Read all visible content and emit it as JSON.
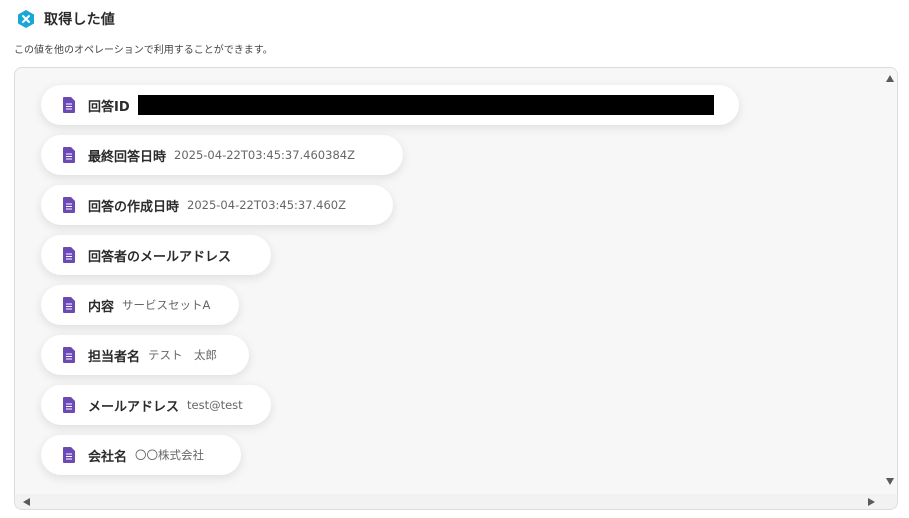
{
  "header": {
    "title": "取得した値",
    "subtitle": "この値を他のオペレーションで利用することができます。"
  },
  "colors": {
    "brand_icon": "#1aa6d8",
    "doc_icon": "#6c4ab6"
  },
  "items": [
    {
      "label": "回答ID",
      "value": "",
      "redacted": true
    },
    {
      "label": "最終回答日時",
      "value": "2025-04-22T03:45:37.460384Z"
    },
    {
      "label": "回答の作成日時",
      "value": "2025-04-22T03:45:37.460Z"
    },
    {
      "label": "回答者のメールアドレス",
      "value": ""
    },
    {
      "label": "内容",
      "value": "サービスセットA"
    },
    {
      "label": "担当者名",
      "value": "テスト　太郎"
    },
    {
      "label": "メールアドレス",
      "value": "test@test"
    },
    {
      "label": "会社名",
      "value": "〇〇株式会社"
    }
  ]
}
